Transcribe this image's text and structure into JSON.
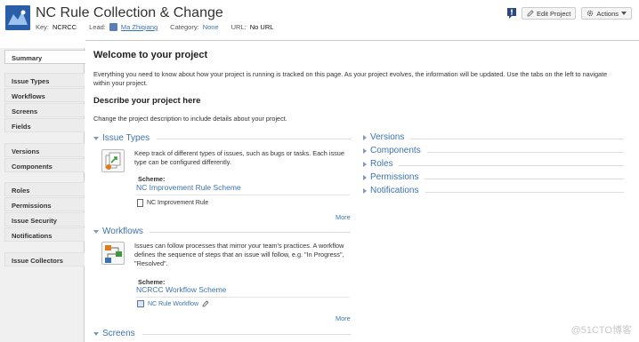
{
  "header": {
    "title": "NC Rule Collection & Change",
    "key_label": "Key:",
    "key_value": "NCRCC",
    "lead_label": "Lead:",
    "lead_value": "Ma Zhiqiang",
    "category_label": "Category:",
    "category_value": "None",
    "url_label": "URL:",
    "url_value": "No URL",
    "edit_button": "Edit Project",
    "actions_button": "Actions"
  },
  "sidebar": {
    "items": [
      {
        "label": "Summary"
      },
      {
        "label": "Issue Types"
      },
      {
        "label": "Workflows"
      },
      {
        "label": "Screens"
      },
      {
        "label": "Fields"
      },
      {
        "label": "Versions"
      },
      {
        "label": "Components"
      },
      {
        "label": "Roles"
      },
      {
        "label": "Permissions"
      },
      {
        "label": "Issue Security"
      },
      {
        "label": "Notifications"
      },
      {
        "label": "Issue Collectors"
      }
    ]
  },
  "main": {
    "welcome_title": "Welcome to your project",
    "welcome_text": "Everything you need to know about how your project is running is tracked on this page. As your project evolves, the information will be updated. Use the tabs on the left to navigate within your project.",
    "describe_title": "Describe your project here",
    "describe_text": "Change the project description to include details about your project.",
    "issue_types": {
      "title": "Issue Types",
      "desc": "Keep track of different types of issues, such as bugs or tasks. Each issue type can be configured differently.",
      "scheme_label": "Scheme:",
      "scheme_name": "NC Improvement Rule Scheme",
      "item": "NC Improvement Rule",
      "more": "More"
    },
    "workflows": {
      "title": "Workflows",
      "desc": "Issues can follow processes that mirror your team's practices. A workflow defines the sequence of steps that an issue will follow, e.g. \"In Progress\", \"Resolved\".",
      "scheme_label": "Scheme:",
      "scheme_name": "NCRCC Workflow Scheme",
      "item": "NC Rule Workflow",
      "more": "More"
    },
    "screens": {
      "title": "Screens"
    },
    "right_sections": [
      {
        "title": "Versions"
      },
      {
        "title": "Components"
      },
      {
        "title": "Roles"
      },
      {
        "title": "Permissions"
      },
      {
        "title": "Notifications"
      }
    ]
  },
  "watermark": "@51CTO博客",
  "colors": {
    "link": "#3b73af",
    "sidebar_bg": "#f0f0f0",
    "avatar": "#2a5ea8"
  }
}
